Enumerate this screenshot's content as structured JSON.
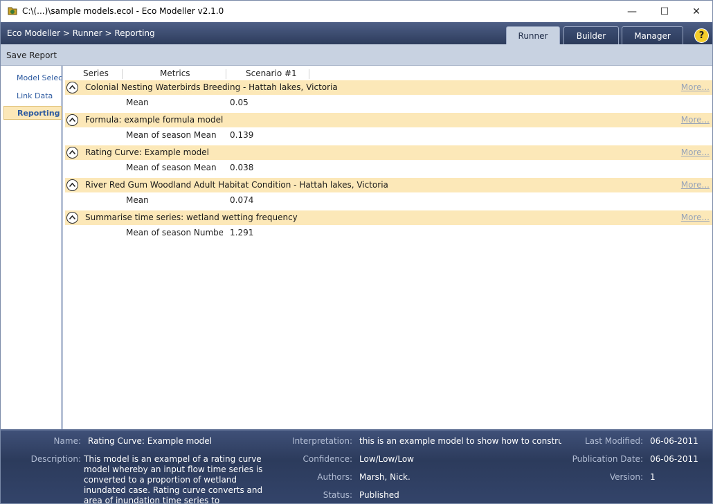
{
  "window": {
    "title": "C:\\(...)\\sample models.ecol - Eco Modeller v2.1.0",
    "minimize_glyph": "—",
    "maximize_glyph": "☐",
    "close_glyph": "✕"
  },
  "header": {
    "breadcrumb": "Eco Modeller > Runner > Reporting",
    "tabs": [
      {
        "label": "Runner",
        "active": true
      },
      {
        "label": "Builder",
        "active": false
      },
      {
        "label": "Manager",
        "active": false
      }
    ],
    "help_label": "?"
  },
  "toolbar": {
    "save_report": "Save Report"
  },
  "sidebar": {
    "items": [
      {
        "label": "Model Select",
        "active": false
      },
      {
        "label": "Link Data",
        "active": false
      },
      {
        "label": "Reporting",
        "active": true
      }
    ]
  },
  "grid": {
    "columns": [
      "Series",
      "Metrics",
      "Scenario #1"
    ],
    "more_label": "More...",
    "groups": [
      {
        "title": "Colonial Nesting Waterbirds Breeding - Hattah lakes, Victoria",
        "metric": "Mean",
        "value": "0.05"
      },
      {
        "title": "Formula: example formula model",
        "metric": "Mean of season Mean",
        "value": "0.139"
      },
      {
        "title": "Rating Curve: Example model",
        "metric": "Mean of season Mean",
        "value": "0.038"
      },
      {
        "title": "River Red Gum Woodland Adult Habitat Condition - Hattah lakes, Victoria",
        "metric": "Mean",
        "value": "0.074"
      },
      {
        "title": "Summarise time series: wetland wetting frequency",
        "metric": "Mean of season Number c",
        "value": "1.291"
      }
    ]
  },
  "details": {
    "name_label": "Name:",
    "name": "Rating Curve: Example model",
    "description_label": "Description:",
    "description": "This model is an exampel of a rating curve model whereby an input flow time series is converted to a proportion of wetland inundated case. Rating curve converts and area of inundation time series to",
    "interpretation_label": "Interpretation:",
    "interpretation": "this is an example model to show how to construct a ra",
    "confidence_label": "Confidence:",
    "confidence": "Low/Low/Low",
    "authors_label": "Authors:",
    "authors": "Marsh, Nick.",
    "status_label": "Status:",
    "status": "Published",
    "last_modified_label": "Last Modified:",
    "last_modified": "06-06-2011",
    "publication_date_label": "Publication Date:",
    "publication_date": "06-06-2011",
    "version_label": "Version:",
    "version": "1"
  },
  "colors": {
    "header_dark": "#2d3c5c",
    "toolbar_bg": "#c8d2e1",
    "group_bg": "#fce8b8",
    "link_blue": "#2d5aa0",
    "help_yellow": "#f3cc2a"
  }
}
